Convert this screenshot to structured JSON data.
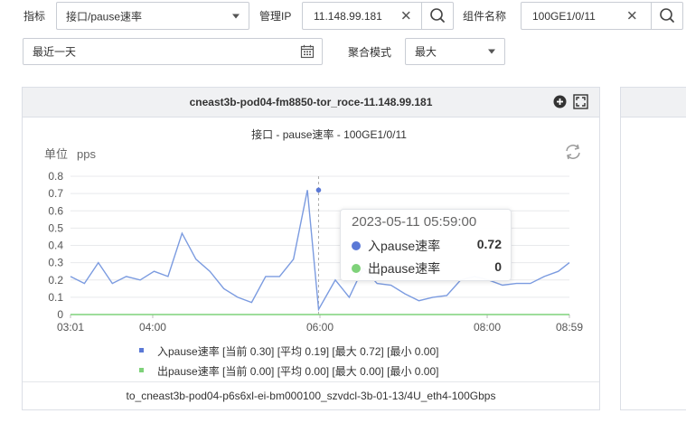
{
  "filters": {
    "indicator_label": "指标",
    "indicator_value": "接口/pause速率",
    "mgmt_ip_label": "管理IP",
    "mgmt_ip_value": "11.148.99.181",
    "component_label": "组件名称",
    "component_value": "100GE1/0/11",
    "time_range_value": "最近一天",
    "agg_mode_label": "聚合模式",
    "agg_mode_value": "最大"
  },
  "card": {
    "device_title": "cneast3b-pod04-fm8850-tor_roce-11.148.99.181",
    "footer": "to_cneast3b-pod04-p6s6xl-ei-bm000100_szvdcl-3b-01-13/4U_eth4-100Gbps",
    "unit_label": "单位",
    "unit_value": "pps"
  },
  "icons": [
    "plus-circle-icon",
    "fullscreen-icon",
    "refresh-icon",
    "calendar-icon",
    "search-icon",
    "close-icon",
    "caret-down-icon"
  ],
  "chart_data": {
    "type": "line",
    "title": "接口 - pause速率 - 100GE1/0/11",
    "ylim": [
      0,
      0.8
    ],
    "yticks": [
      0,
      0.1,
      0.2,
      0.3,
      0.4,
      0.5,
      0.6,
      0.7,
      0.8
    ],
    "xlim": [
      "03:01",
      "08:59"
    ],
    "xticks": [
      "03:01",
      "04:00",
      "06:00",
      "08:00",
      "08:59"
    ],
    "grid": true,
    "series": [
      {
        "name": "入pause速率",
        "color": "#7b9be0",
        "x": [
          "03:01",
          "03:11",
          "03:21",
          "03:31",
          "03:41",
          "03:51",
          "04:01",
          "04:11",
          "04:21",
          "04:31",
          "04:41",
          "04:51",
          "05:01",
          "05:11",
          "05:21",
          "05:31",
          "05:41",
          "05:51",
          "05:59",
          "06:11",
          "06:21",
          "06:31",
          "06:41",
          "06:51",
          "07:01",
          "07:11",
          "07:21",
          "07:31",
          "07:41",
          "07:51",
          "08:01",
          "08:11",
          "08:21",
          "08:31",
          "08:41",
          "08:51",
          "08:59"
        ],
        "values": [
          0.22,
          0.18,
          0.3,
          0.18,
          0.22,
          0.2,
          0.25,
          0.22,
          0.47,
          0.32,
          0.25,
          0.15,
          0.1,
          0.07,
          0.22,
          0.22,
          0.32,
          0.72,
          0.03,
          0.2,
          0.1,
          0.27,
          0.18,
          0.17,
          0.12,
          0.08,
          0.1,
          0.11,
          0.2,
          0.22,
          0.2,
          0.17,
          0.18,
          0.18,
          0.22,
          0.25,
          0.3
        ]
      },
      {
        "name": "出pause速率",
        "color": "#7fd27a",
        "x": [
          "03:01",
          "08:59"
        ],
        "values": [
          0,
          0
        ]
      }
    ],
    "tooltip": {
      "time": "2023-05-11 05:59:00",
      "rows": [
        {
          "name": "入pause速率",
          "value": "0.72",
          "color": "#5b79d6"
        },
        {
          "name": "出pause速率",
          "value": "0",
          "color": "#7fd27a"
        }
      ]
    },
    "legend": [
      {
        "text": "入pause速率 [当前 0.30] [平均 0.19] [最大 0.72] [最小 0.00]",
        "color": "#5b79d6"
      },
      {
        "text": "出pause速率 [当前 0.00] [平均 0.00] [最大 0.00] [最小 0.00]",
        "color": "#7fd27a"
      }
    ]
  }
}
